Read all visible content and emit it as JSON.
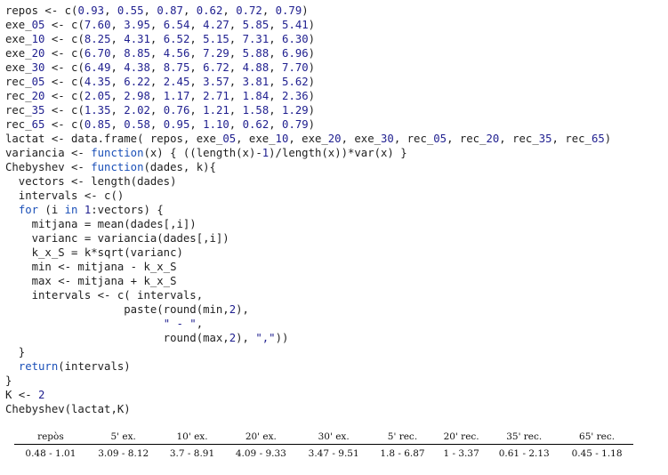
{
  "code_lines": [
    "repos <- c(0.93, 0.55, 0.87, 0.62, 0.72, 0.79)",
    "exe_05 <- c(7.60, 3.95, 6.54, 4.27, 5.85, 5.41)",
    "exe_10 <- c(8.25, 4.31, 6.52, 5.15, 7.31, 6.30)",
    "exe_20 <- c(6.70, 8.85, 4.56, 7.29, 5.88, 6.96)",
    "exe_30 <- c(6.49, 4.38, 8.75, 6.72, 4.88, 7.70)",
    "rec_05 <- c(4.35, 6.22, 2.45, 3.57, 3.81, 5.62)",
    "rec_20 <- c(2.05, 2.98, 1.17, 2.71, 1.84, 2.36)",
    "rec_35 <- c(1.35, 2.02, 0.76, 1.21, 1.58, 1.29)",
    "rec_65 <- c(0.85, 0.58, 0.95, 1.10, 0.62, 0.79)",
    "lactat <- data.frame( repos, exe_05, exe_10, exe_20, exe_30, rec_05, rec_20, rec_35, rec_65)",
    "variancia <- function(x) { ((length(x)-1)/length(x))*var(x) }",
    "Chebyshev <- function(dades, k){",
    "  vectors <- length(dades)",
    "  intervals <- c()",
    "  for (i in 1:vectors) {",
    "    mitjana = mean(dades[,i])",
    "    varianc = variancia(dades[,i])",
    "    k_x_S = k*sqrt(varianc)",
    "    min <- mitjana - k_x_S",
    "    max <- mitjana + k_x_S",
    "    intervals <- c( intervals,",
    "                  paste(round(min,2),",
    "                        \" - \",",
    "                        round(max,2), \",\"))",
    "  }",
    "  return(intervals)",
    "}",
    "K <- 2",
    "Chebyshev(lactat,K)"
  ],
  "table": {
    "headers": [
      "repòs",
      "5' ex.",
      "10' ex.",
      "20' ex.",
      "30' ex.",
      "5' rec.",
      "20' rec.",
      "35' rec.",
      "65' rec."
    ],
    "row": [
      "0.48 - 1.01",
      "3.09 - 8.12",
      "3.7 - 8.91",
      "4.09 - 9.33",
      "3.47 - 9.51",
      "1.8 - 6.87",
      "1 - 3.37",
      "0.61 - 2.13",
      "0.45 - 1.18"
    ]
  },
  "colors": {
    "keyword": "#1b50b8",
    "number": "#1f1f8f",
    "text": "#1f1f1f"
  }
}
